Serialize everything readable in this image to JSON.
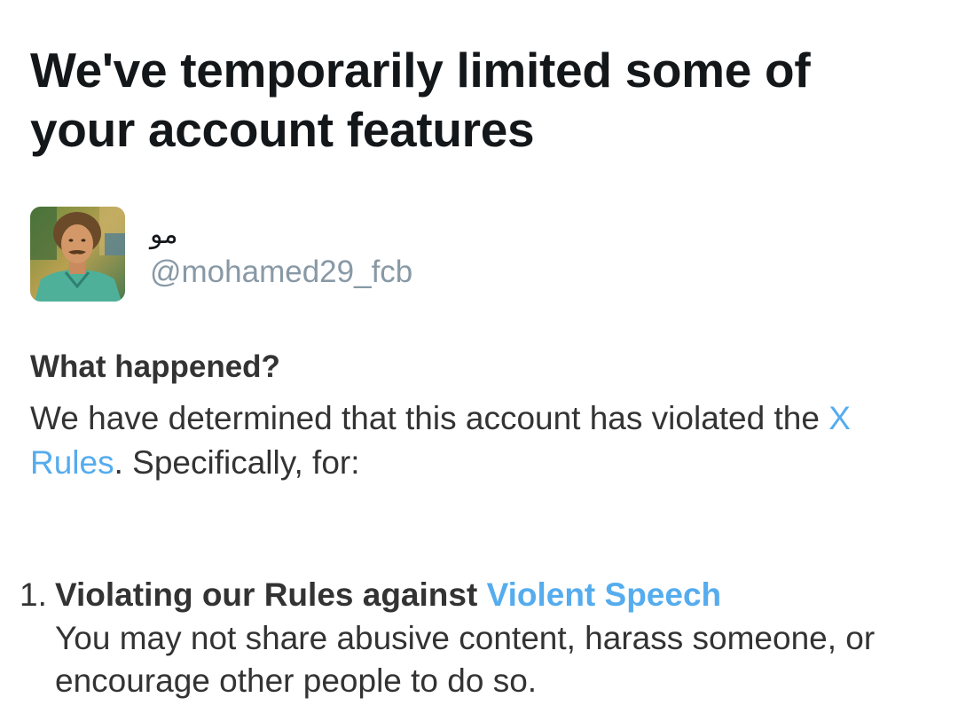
{
  "header": {
    "title": "We've temporarily limited some of your account features"
  },
  "account": {
    "display_name": "مو",
    "handle": "@mohamed29_fcb",
    "avatar_icon": "profile-photo"
  },
  "what_happened": {
    "heading": "What happened?",
    "text_before_link": "We have determined that this account has violated the ",
    "rules_link": "X Rules",
    "text_after_link": ". Specifically, for:"
  },
  "violations": [
    {
      "number": "1.",
      "title_prefix": "Violating our Rules against ",
      "title_link": "Violent Speech",
      "description": "You may not share abusive content, harass someone, or encourage other people to do so."
    }
  ],
  "colors": {
    "link": "#55acee",
    "text": "#333333",
    "title": "#14171a",
    "handle": "#8899a6"
  }
}
